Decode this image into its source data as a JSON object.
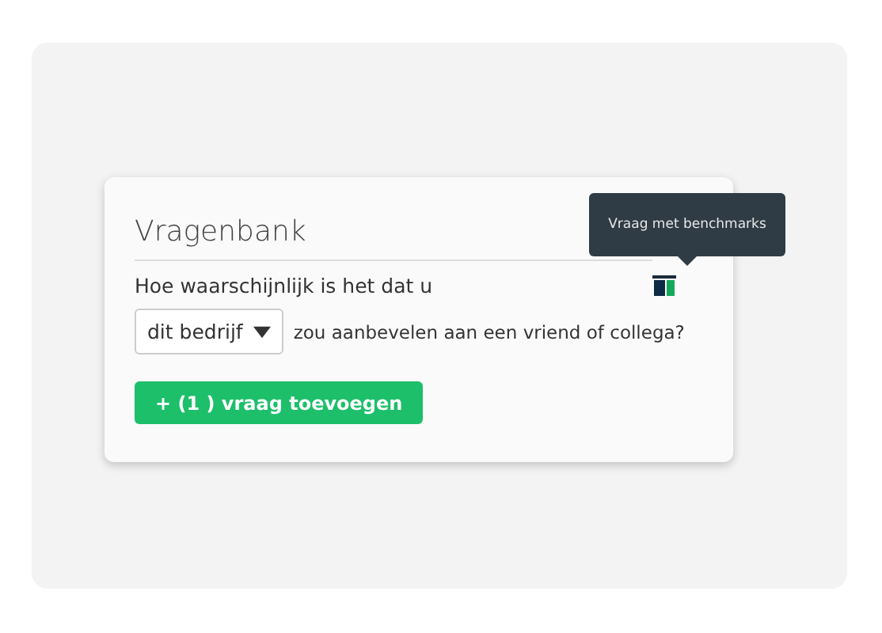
{
  "panel": {
    "title": "Vragenbank",
    "question": {
      "lead": "Hoe waarschijnlijk is het dat u",
      "benchmark_tooltip": "Vraag met benchmarks",
      "dropdown": "dit bedrijf",
      "rest": "zou aanbevelen aan een vriend of collega?"
    },
    "add_button": "+ (1 ) vraag toevoegen"
  }
}
